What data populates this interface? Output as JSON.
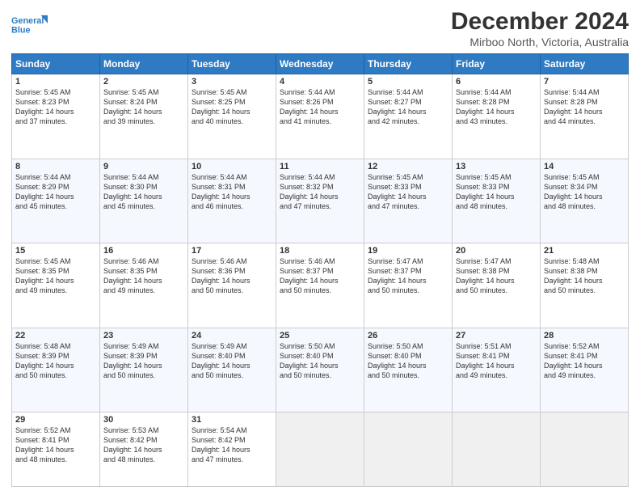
{
  "logo": {
    "line1": "General",
    "line2": "Blue"
  },
  "title": "December 2024",
  "location": "Mirboo North, Victoria, Australia",
  "days_of_week": [
    "Sunday",
    "Monday",
    "Tuesday",
    "Wednesday",
    "Thursday",
    "Friday",
    "Saturday"
  ],
  "weeks": [
    [
      {
        "day": "1",
        "info": "Sunrise: 5:45 AM\nSunset: 8:23 PM\nDaylight: 14 hours\nand 37 minutes."
      },
      {
        "day": "2",
        "info": "Sunrise: 5:45 AM\nSunset: 8:24 PM\nDaylight: 14 hours\nand 39 minutes."
      },
      {
        "day": "3",
        "info": "Sunrise: 5:45 AM\nSunset: 8:25 PM\nDaylight: 14 hours\nand 40 minutes."
      },
      {
        "day": "4",
        "info": "Sunrise: 5:44 AM\nSunset: 8:26 PM\nDaylight: 14 hours\nand 41 minutes."
      },
      {
        "day": "5",
        "info": "Sunrise: 5:44 AM\nSunset: 8:27 PM\nDaylight: 14 hours\nand 42 minutes."
      },
      {
        "day": "6",
        "info": "Sunrise: 5:44 AM\nSunset: 8:28 PM\nDaylight: 14 hours\nand 43 minutes."
      },
      {
        "day": "7",
        "info": "Sunrise: 5:44 AM\nSunset: 8:28 PM\nDaylight: 14 hours\nand 44 minutes."
      }
    ],
    [
      {
        "day": "8",
        "info": "Sunrise: 5:44 AM\nSunset: 8:29 PM\nDaylight: 14 hours\nand 45 minutes."
      },
      {
        "day": "9",
        "info": "Sunrise: 5:44 AM\nSunset: 8:30 PM\nDaylight: 14 hours\nand 45 minutes."
      },
      {
        "day": "10",
        "info": "Sunrise: 5:44 AM\nSunset: 8:31 PM\nDaylight: 14 hours\nand 46 minutes."
      },
      {
        "day": "11",
        "info": "Sunrise: 5:44 AM\nSunset: 8:32 PM\nDaylight: 14 hours\nand 47 minutes."
      },
      {
        "day": "12",
        "info": "Sunrise: 5:45 AM\nSunset: 8:33 PM\nDaylight: 14 hours\nand 47 minutes."
      },
      {
        "day": "13",
        "info": "Sunrise: 5:45 AM\nSunset: 8:33 PM\nDaylight: 14 hours\nand 48 minutes."
      },
      {
        "day": "14",
        "info": "Sunrise: 5:45 AM\nSunset: 8:34 PM\nDaylight: 14 hours\nand 48 minutes."
      }
    ],
    [
      {
        "day": "15",
        "info": "Sunrise: 5:45 AM\nSunset: 8:35 PM\nDaylight: 14 hours\nand 49 minutes."
      },
      {
        "day": "16",
        "info": "Sunrise: 5:46 AM\nSunset: 8:35 PM\nDaylight: 14 hours\nand 49 minutes."
      },
      {
        "day": "17",
        "info": "Sunrise: 5:46 AM\nSunset: 8:36 PM\nDaylight: 14 hours\nand 50 minutes."
      },
      {
        "day": "18",
        "info": "Sunrise: 5:46 AM\nSunset: 8:37 PM\nDaylight: 14 hours\nand 50 minutes."
      },
      {
        "day": "19",
        "info": "Sunrise: 5:47 AM\nSunset: 8:37 PM\nDaylight: 14 hours\nand 50 minutes."
      },
      {
        "day": "20",
        "info": "Sunrise: 5:47 AM\nSunset: 8:38 PM\nDaylight: 14 hours\nand 50 minutes."
      },
      {
        "day": "21",
        "info": "Sunrise: 5:48 AM\nSunset: 8:38 PM\nDaylight: 14 hours\nand 50 minutes."
      }
    ],
    [
      {
        "day": "22",
        "info": "Sunrise: 5:48 AM\nSunset: 8:39 PM\nDaylight: 14 hours\nand 50 minutes."
      },
      {
        "day": "23",
        "info": "Sunrise: 5:49 AM\nSunset: 8:39 PM\nDaylight: 14 hours\nand 50 minutes."
      },
      {
        "day": "24",
        "info": "Sunrise: 5:49 AM\nSunset: 8:40 PM\nDaylight: 14 hours\nand 50 minutes."
      },
      {
        "day": "25",
        "info": "Sunrise: 5:50 AM\nSunset: 8:40 PM\nDaylight: 14 hours\nand 50 minutes."
      },
      {
        "day": "26",
        "info": "Sunrise: 5:50 AM\nSunset: 8:40 PM\nDaylight: 14 hours\nand 50 minutes."
      },
      {
        "day": "27",
        "info": "Sunrise: 5:51 AM\nSunset: 8:41 PM\nDaylight: 14 hours\nand 49 minutes."
      },
      {
        "day": "28",
        "info": "Sunrise: 5:52 AM\nSunset: 8:41 PM\nDaylight: 14 hours\nand 49 minutes."
      }
    ],
    [
      {
        "day": "29",
        "info": "Sunrise: 5:52 AM\nSunset: 8:41 PM\nDaylight: 14 hours\nand 48 minutes."
      },
      {
        "day": "30",
        "info": "Sunrise: 5:53 AM\nSunset: 8:42 PM\nDaylight: 14 hours\nand 48 minutes."
      },
      {
        "day": "31",
        "info": "Sunrise: 5:54 AM\nSunset: 8:42 PM\nDaylight: 14 hours\nand 47 minutes."
      },
      {
        "day": "",
        "info": ""
      },
      {
        "day": "",
        "info": ""
      },
      {
        "day": "",
        "info": ""
      },
      {
        "day": "",
        "info": ""
      }
    ]
  ]
}
